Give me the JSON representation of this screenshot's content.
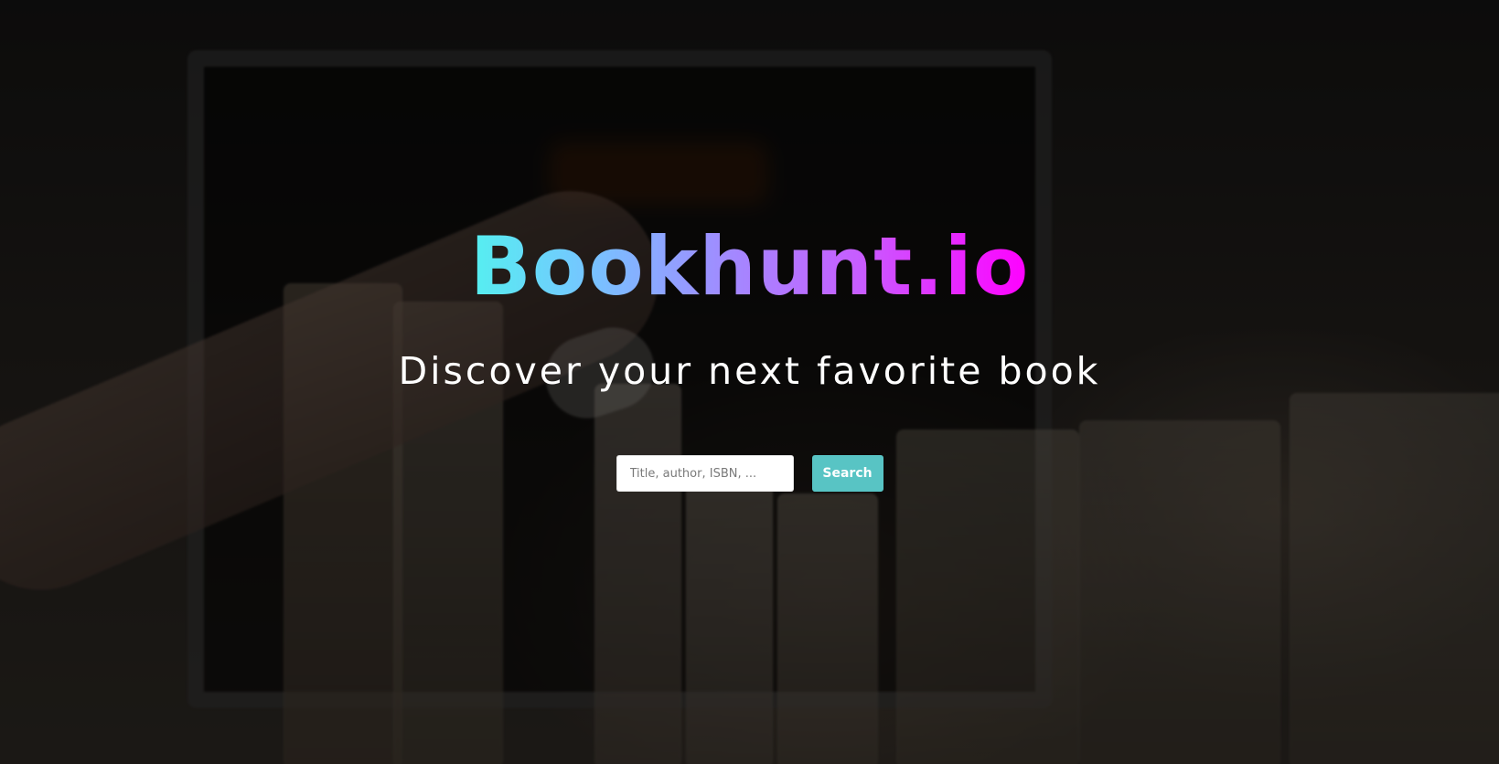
{
  "app": {
    "title": "Bookhunt.io",
    "tagline": "Discover your next favorite book"
  },
  "search": {
    "value": "",
    "placeholder": "Title, author, ISBN, ...",
    "button_label": "Search"
  },
  "colors": {
    "logo_gradient": [
      "#55f0f0",
      "#74c7ff",
      "#a08cff",
      "#c85cff",
      "#ff00ff"
    ],
    "search_button": "#58c4c4",
    "overlay": "rgba(0,0,0,0.52)"
  },
  "background": {
    "description_icon": "bookshelf-photo"
  }
}
